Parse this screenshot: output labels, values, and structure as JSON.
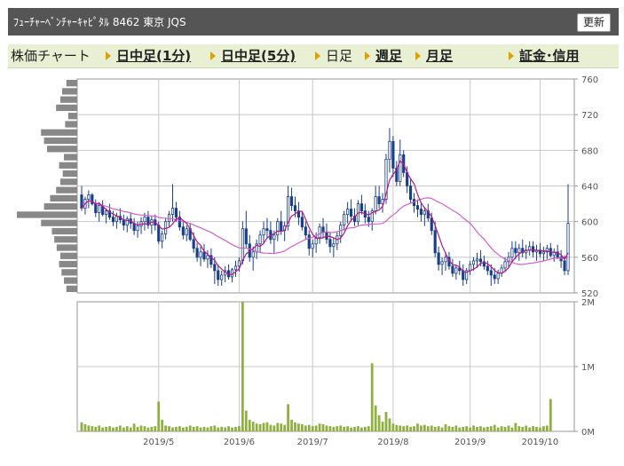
{
  "header": {
    "title": "ﾌｭｰﾁｬｰﾍﾞﾝﾁｬｰｷｬﾋﾟﾀﾙ  8462  東京 JQS",
    "refresh_label": "更新"
  },
  "nav": {
    "label": "株価チャート",
    "intraday_1": "日中足(1分)",
    "intraday_5": "日中足(5分)",
    "daily": "日足",
    "weekly": "週足",
    "monthly": "月足",
    "margin": "証金･信用"
  },
  "colors": {
    "candle": "#1a3f8a",
    "ma_short": "#b5178c",
    "ma_long": "#d060d0",
    "volume": "#8fb040",
    "volume_profile": "#888888",
    "grid": "#c8c8c8"
  },
  "chart_data": [
    {
      "type": "candlestick",
      "ylim": [
        520,
        760
      ],
      "yticks": [
        "760",
        "720",
        "680",
        "640",
        "600",
        "560",
        "520"
      ],
      "series": [
        {
          "kind": "candles",
          "points": [
            [
              630,
              640,
              612,
              615
            ],
            [
              615,
              628,
              608,
              625
            ],
            [
              625,
              635,
              615,
              630
            ],
            [
              630,
              632,
              618,
              620
            ],
            [
              620,
              625,
              605,
              610
            ],
            [
              610,
              622,
              600,
              618
            ],
            [
              618,
              624,
              606,
              608
            ],
            [
              608,
              615,
              598,
              612
            ],
            [
              612,
              620,
              602,
              605
            ],
            [
              605,
              612,
              595,
              600
            ],
            [
              600,
              610,
              592,
              606
            ],
            [
              606,
              615,
              598,
              602
            ],
            [
              602,
              608,
              590,
              596
            ],
            [
              596,
              606,
              588,
              603
            ],
            [
              603,
              610,
              592,
              598
            ],
            [
              598,
              604,
              585,
              590
            ],
            [
              590,
              600,
              582,
              595
            ],
            [
              595,
              605,
              586,
              600
            ],
            [
              600,
              610,
              590,
              605
            ],
            [
              605,
              612,
              592,
              596
            ],
            [
              596,
              606,
              586,
              602
            ],
            [
              602,
              608,
              590,
              596
            ],
            [
              596,
              600,
              575,
              578
            ],
            [
              578,
              590,
              570,
              586
            ],
            [
              586,
              604,
              580,
              600
            ],
            [
              600,
              612,
              594,
              608
            ],
            [
              608,
              642,
              600,
              615
            ],
            [
              615,
              622,
              600,
              605
            ],
            [
              605,
              612,
              590,
              594
            ],
            [
              594,
              600,
              580,
              585
            ],
            [
              585,
              596,
              578,
              592
            ],
            [
              592,
              598,
              578,
              580
            ],
            [
              580,
              588,
              565,
              570
            ],
            [
              570,
              576,
              555,
              560
            ],
            [
              560,
              572,
              550,
              566
            ],
            [
              566,
              575,
              555,
              558
            ],
            [
              558,
              568,
              548,
              562
            ],
            [
              562,
              570,
              548,
              552
            ],
            [
              552,
              560,
              530,
              545
            ],
            [
              545,
              552,
              528,
              535
            ],
            [
              535,
              545,
              528,
              540
            ],
            [
              540,
              550,
              532,
              545
            ],
            [
              545,
              552,
              535,
              538
            ],
            [
              538,
              548,
              532,
              546
            ],
            [
              546,
              556,
              538,
              550
            ],
            [
              550,
              560,
              544,
              556
            ],
            [
              556,
              600,
              552,
              592
            ],
            [
              592,
              612,
              570,
              575
            ],
            [
              575,
              585,
              555,
              560
            ],
            [
              560,
              572,
              545,
              566
            ],
            [
              566,
              580,
              558,
              575
            ],
            [
              575,
              590,
              565,
              585
            ],
            [
              585,
              600,
              575,
              592
            ],
            [
              592,
              604,
              582,
              590
            ],
            [
              590,
              600,
              575,
              580
            ],
            [
              580,
              590,
              565,
              585
            ],
            [
              585,
              604,
              578,
              600
            ],
            [
              600,
              612,
              585,
              590
            ],
            [
              590,
              600,
              578,
              595
            ],
            [
              595,
              640,
              590,
              628
            ],
            [
              628,
              638,
              612,
              618
            ],
            [
              618,
              628,
              605,
              612
            ],
            [
              612,
              622,
              596,
              605
            ],
            [
              605,
              612,
              590,
              594
            ],
            [
              594,
              600,
              580,
              585
            ],
            [
              585,
              590,
              562,
              570
            ],
            [
              570,
              580,
              560,
              575
            ],
            [
              575,
              588,
              565,
              582
            ],
            [
              582,
              598,
              575,
              594
            ],
            [
              594,
              604,
              582,
              588
            ],
            [
              588,
              598,
              575,
              580
            ],
            [
              580,
              588,
              565,
              572
            ],
            [
              572,
              582,
              560,
              575
            ],
            [
              575,
              588,
              568,
              584
            ],
            [
              584,
              600,
              576,
              596
            ],
            [
              596,
              612,
              590,
              608
            ],
            [
              608,
              622,
              598,
              614
            ],
            [
              614,
              625,
              600,
              606
            ],
            [
              606,
              615,
              595,
              600
            ],
            [
              600,
              624,
              596,
              620
            ],
            [
              620,
              630,
              608,
              612
            ],
            [
              612,
              620,
              598,
              605
            ],
            [
              605,
              612,
              594,
              600
            ],
            [
              600,
              615,
              590,
              612
            ],
            [
              612,
              640,
              608,
              628
            ],
            [
              628,
              640,
              615,
              620
            ],
            [
              620,
              632,
              610,
              625
            ],
            [
              625,
              676,
              620,
              670
            ],
            [
              670,
              705,
              655,
              690
            ],
            [
              690,
              696,
              650,
              660
            ],
            [
              660,
              668,
              640,
              645
            ],
            [
              645,
              692,
              640,
              675
            ],
            [
              675,
              680,
              650,
              655
            ],
            [
              655,
              662,
              632,
              640
            ],
            [
              640,
              648,
              620,
              625
            ],
            [
              625,
              632,
              610,
              618
            ],
            [
              618,
              625,
              605,
              614
            ],
            [
              614,
              622,
              600,
              608
            ],
            [
              608,
              616,
              595,
              612
            ],
            [
              612,
              620,
              600,
              604
            ],
            [
              604,
              610,
              585,
              590
            ],
            [
              590,
              600,
              560,
              565
            ],
            [
              565,
              572,
              545,
              552
            ],
            [
              552,
              560,
              540,
              555
            ],
            [
              555,
              566,
              545,
              560
            ],
            [
              560,
              566,
              546,
              550
            ],
            [
              550,
              558,
              538,
              542
            ],
            [
              542,
              552,
              535,
              548
            ],
            [
              548,
              556,
              540,
              545
            ],
            [
              545,
              552,
              528,
              535
            ],
            [
              535,
              548,
              530,
              545
            ],
            [
              545,
              556,
              540,
              552
            ],
            [
              552,
              560,
              545,
              556
            ],
            [
              556,
              565,
              548,
              558
            ],
            [
              558,
              568,
              550,
              555
            ],
            [
              555,
              562,
              546,
              550
            ],
            [
              550,
              556,
              540,
              545
            ],
            [
              545,
              552,
              528,
              540
            ],
            [
              540,
              548,
              530,
              536
            ],
            [
              536,
              546,
              530,
              542
            ],
            [
              542,
              552,
              538,
              548
            ],
            [
              548,
              560,
              544,
              555
            ],
            [
              555,
              566,
              548,
              560
            ],
            [
              560,
              578,
              554,
              570
            ],
            [
              570,
              578,
              558,
              565
            ],
            [
              565,
              575,
              556,
              570
            ],
            [
              570,
              580,
              560,
              565
            ],
            [
              565,
              574,
              558,
              568
            ],
            [
              568,
              578,
              562,
              572
            ],
            [
              572,
              578,
              560,
              566
            ],
            [
              566,
              574,
              556,
              568
            ],
            [
              568,
              576,
              560,
              564
            ],
            [
              564,
              572,
              556,
              566
            ],
            [
              566,
              574,
              558,
              570
            ],
            [
              570,
              576,
              560,
              562
            ],
            [
              562,
              570,
              555,
              566
            ],
            [
              566,
              574,
              558,
              560
            ],
            [
              560,
              568,
              548,
              556
            ],
            [
              556,
              562,
              540,
              545
            ],
            [
              545,
              642,
              540,
              598
            ]
          ]
        },
        {
          "name": "",
          "kind": "ma_short"
        },
        {
          "name": "",
          "kind": "ma_long"
        }
      ]
    },
    {
      "type": "bar",
      "ylim": [
        0,
        2000000
      ],
      "yticks": [
        "2M",
        "1M",
        "0M"
      ],
      "x": [
        "2019/5",
        "2019/6",
        "2019/7",
        "2019/8",
        "2019/9",
        "2019/10"
      ],
      "values": [
        140000,
        110000,
        90000,
        80000,
        70000,
        90000,
        60000,
        70000,
        80000,
        60000,
        70000,
        90000,
        60000,
        80000,
        60000,
        120000,
        70000,
        90000,
        80000,
        60000,
        70000,
        80000,
        460000,
        180000,
        90000,
        80000,
        60000,
        70000,
        80000,
        60000,
        70000,
        90000,
        70000,
        80000,
        60000,
        70000,
        60000,
        80000,
        90000,
        60000,
        70000,
        60000,
        80000,
        60000,
        70000,
        80000,
        2000000,
        320000,
        180000,
        150000,
        120000,
        110000,
        130000,
        140000,
        100000,
        90000,
        130000,
        120000,
        100000,
        420000,
        180000,
        140000,
        120000,
        110000,
        90000,
        100000,
        80000,
        90000,
        120000,
        110000,
        90000,
        80000,
        70000,
        80000,
        90000,
        70000,
        80000,
        60000,
        70000,
        80000,
        60000,
        70000,
        80000,
        1050000,
        400000,
        250000,
        150000,
        300000,
        200000,
        120000,
        100000,
        90000,
        80000,
        90000,
        70000,
        80000,
        120000,
        90000,
        100000,
        80000,
        90000,
        70000,
        80000,
        60000,
        110000,
        80000,
        70000,
        90000,
        60000,
        70000,
        80000,
        60000,
        90000,
        70000,
        80000,
        60000,
        70000,
        80000,
        100000,
        60000,
        80000,
        70000,
        90000,
        60000,
        130000,
        80000,
        70000,
        90000,
        60000,
        80000,
        70000,
        60000,
        80000,
        90000,
        500000
      ]
    }
  ],
  "volume_profile": [
    0.18,
    0.22,
    0.26,
    0.3,
    0.28,
    0.34,
    0.38,
    0.42,
    0.6,
    1.0,
    0.55,
    0.45,
    0.35,
    0.28,
    0.24,
    0.3,
    0.22,
    0.5,
    0.55,
    0.6,
    0.2,
    0.15,
    0.35,
    0.28,
    0.25,
    0.18
  ]
}
